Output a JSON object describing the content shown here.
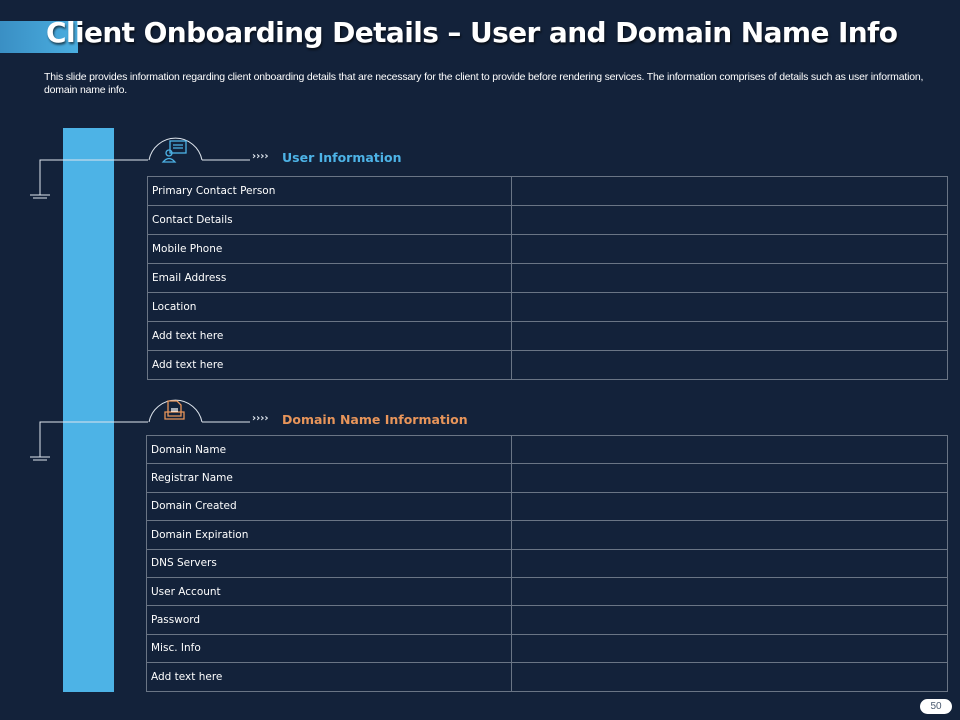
{
  "title": "Client Onboarding Details – User and Domain Name Info",
  "description": "This slide provides information regarding client onboarding details that are necessary for the client to provide before rendering services. The information comprises of details such as user information, domain name info.",
  "user_section": {
    "title": "User Information",
    "color": "#4db3e6",
    "icon": "user-message-icon",
    "rows": [
      "Primary Contact Person",
      "Contact Details",
      "Mobile Phone",
      "Email Address",
      "Location",
      "Add text here",
      "Add text here"
    ]
  },
  "domain_section": {
    "title": "Domain Name Information",
    "color": "#e8955a",
    "icon": "document-icon",
    "rows": [
      "Domain Name",
      "Registrar Name",
      "Domain Created",
      "Domain Expiration",
      "DNS Servers",
      "User Account",
      "Password",
      "Misc. Info",
      "Add text here"
    ]
  },
  "arrows": "››››",
  "page_number": "50"
}
